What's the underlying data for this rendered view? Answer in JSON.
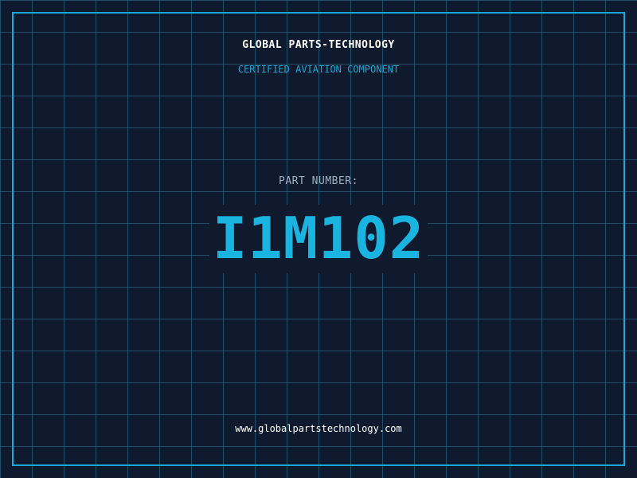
{
  "brand": "GLOBAL PARTS-TECHNOLOGY",
  "subtitle": "CERTIFIED AVIATION COMPONENT",
  "part": {
    "label": "PART NUMBER:",
    "number": "I1M102"
  },
  "footer": {
    "url": "www.globalpartstechnology.com"
  },
  "colors": {
    "background": "#0f1a2e",
    "accent": "#1aa8d8",
    "grid": "#2d7896"
  }
}
